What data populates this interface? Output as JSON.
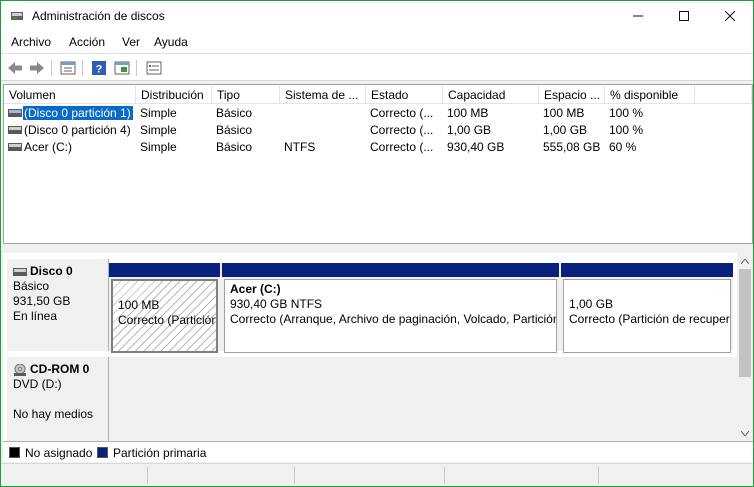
{
  "window": {
    "title": "Administración de discos",
    "minimize": "—",
    "maximize": "☐",
    "close": "✕"
  },
  "menu": [
    "Archivo",
    "Acción",
    "Ver",
    "Ayuda"
  ],
  "toolbar": {
    "back_icon": "back-arrow-icon",
    "forward_icon": "forward-arrow-icon",
    "properties_icon": "properties-icon",
    "help_icon": "help-icon",
    "console_icon": "console-view-icon",
    "settings_icon": "settings-list-icon"
  },
  "volumes": {
    "columns": [
      "Volumen",
      "Distribución",
      "Tipo",
      "Sistema de ...",
      "Estado",
      "Capacidad",
      "Espacio ...",
      "% disponible"
    ],
    "rows": [
      {
        "volumen": "(Disco 0 partición 1)",
        "distribucion": "Simple",
        "tipo": "Básico",
        "sistema": "",
        "estado": "Correcto (...",
        "capacidad": "100 MB",
        "espacio": "100 MB",
        "disponible": "100 %",
        "selected": true
      },
      {
        "volumen": "(Disco 0 partición 4)",
        "distribucion": "Simple",
        "tipo": "Básico",
        "sistema": "",
        "estado": "Correcto (...",
        "capacidad": "1,00 GB",
        "espacio": "1,00 GB",
        "disponible": "100 %",
        "selected": false
      },
      {
        "volumen": "Acer (C:)",
        "distribucion": "Simple",
        "tipo": "Básico",
        "sistema": "NTFS",
        "estado": "Correcto (...",
        "capacidad": "930,40 GB",
        "espacio": "555,08 GB",
        "disponible": "60 %",
        "selected": false
      }
    ]
  },
  "disks": {
    "disk0": {
      "name": "Disco 0",
      "type": "Básico",
      "size": "931,50 GB",
      "status": "En línea",
      "partitions": [
        {
          "title": "",
          "size": "100 MB",
          "status": "Correcto (Partición de sistema EFI)"
        },
        {
          "title": "Acer  (C:)",
          "size": "930,40 GB NTFS",
          "status": "Correcto (Arranque, Archivo de paginación, Volcado, Partición primaria)"
        },
        {
          "title": "",
          "size": "1,00 GB",
          "status": "Correcto (Partición de recuperación)"
        }
      ]
    },
    "cdrom0": {
      "name": "CD-ROM 0",
      "type": "DVD (D:)",
      "status": "No hay medios"
    }
  },
  "legend": {
    "unallocated": "No asignado",
    "primary": "Partición primaria",
    "unallocated_color": "#000000",
    "primary_color": "#0a1f7e"
  }
}
